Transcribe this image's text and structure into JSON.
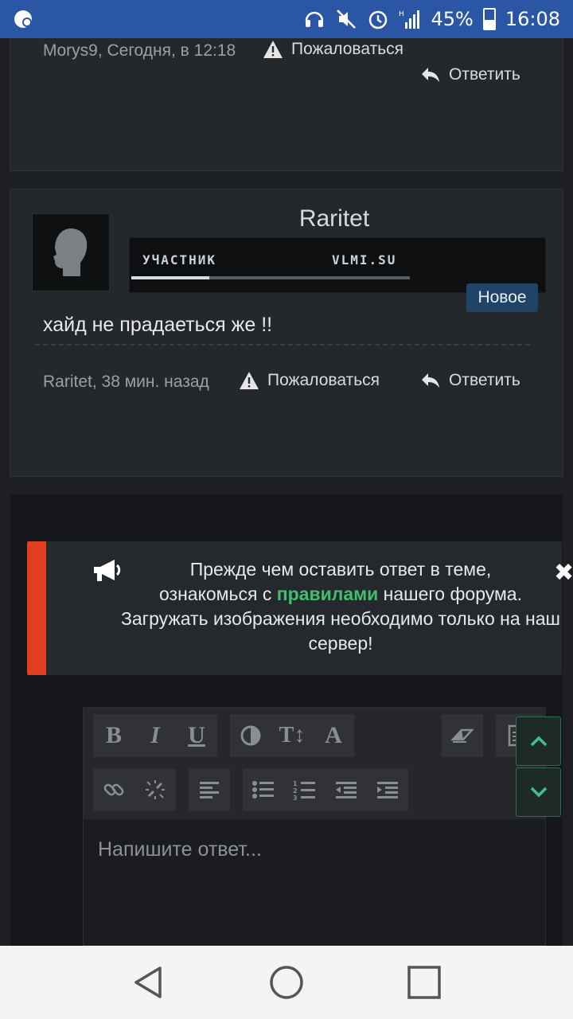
{
  "status_bar": {
    "battery": "45%",
    "time": "16:08",
    "network": "H"
  },
  "post_top": {
    "meta": "Morys9, Сегодня, в 12:18",
    "report_label": "Пожаловаться",
    "reply_label": "Ответить"
  },
  "post_main": {
    "username": "Raritet",
    "rank_left": "УЧАСТНИК",
    "rank_right": "VLMI.SU",
    "rank_progress": 0.28,
    "badge": "Новое",
    "text": "хайд не прадаеться же !!",
    "meta": "Raritet, 38 мин. назад",
    "report_label": "Пожаловаться",
    "reply_label": "Ответить"
  },
  "notice": {
    "line1": "Прежде чем оставить ответ в теме,",
    "line2_pre": "ознакомься с ",
    "line2_link": "правилами",
    "line2_post": " нашего форума.",
    "line3": "Загружать изображения необходимо только на наш сервер!",
    "accent_color": "#e23d1e",
    "link_color": "#3fbf6f"
  },
  "editor": {
    "placeholder": "Напишите ответ...",
    "toolbar_row1": [
      "bold-icon",
      "italic-icon",
      "underline-icon",
      "color-icon",
      "font-size-icon",
      "font-icon",
      "eraser-icon",
      "paste-icon"
    ],
    "toolbar_row2": [
      "link-icon",
      "unlink-icon",
      "align-icon",
      "bullet-list-icon",
      "numbered-list-icon",
      "outdent-icon",
      "indent-icon"
    ]
  }
}
